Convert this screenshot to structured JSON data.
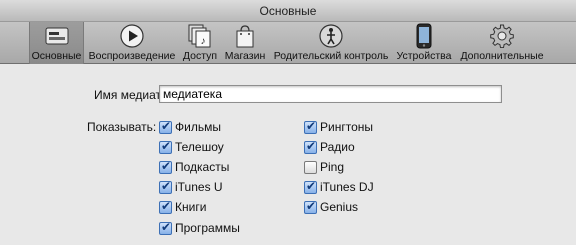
{
  "window": {
    "title": "Основные"
  },
  "toolbar": {
    "items": [
      {
        "label": "Основные",
        "icon": "general-icon"
      },
      {
        "label": "Воспроизведение",
        "icon": "play-icon"
      },
      {
        "label": "Доступ",
        "icon": "sharing-icon"
      },
      {
        "label": "Магазин",
        "icon": "store-bag-icon"
      },
      {
        "label": "Родительский контроль",
        "icon": "parental-icon"
      },
      {
        "label": "Устройства",
        "icon": "iphone-icon"
      },
      {
        "label": "Дополнительные",
        "icon": "gear-icon"
      }
    ],
    "selected": "Основные"
  },
  "library": {
    "label": "Имя медиатеки:",
    "value": "медиатека"
  },
  "show": {
    "label": "Показывать:",
    "left": [
      {
        "label": "Фильмы",
        "checked": true
      },
      {
        "label": "Телешоу",
        "checked": true
      },
      {
        "label": "Подкасты",
        "checked": true
      },
      {
        "label": "iTunes U",
        "checked": true
      },
      {
        "label": "Книги",
        "checked": true
      },
      {
        "label": "Программы",
        "checked": true
      }
    ],
    "right": [
      {
        "label": "Рингтоны",
        "checked": true
      },
      {
        "label": "Радио",
        "checked": true
      },
      {
        "label": "Ping",
        "checked": false
      },
      {
        "label": "iTunes DJ",
        "checked": true
      },
      {
        "label": "Genius",
        "checked": true
      }
    ]
  }
}
